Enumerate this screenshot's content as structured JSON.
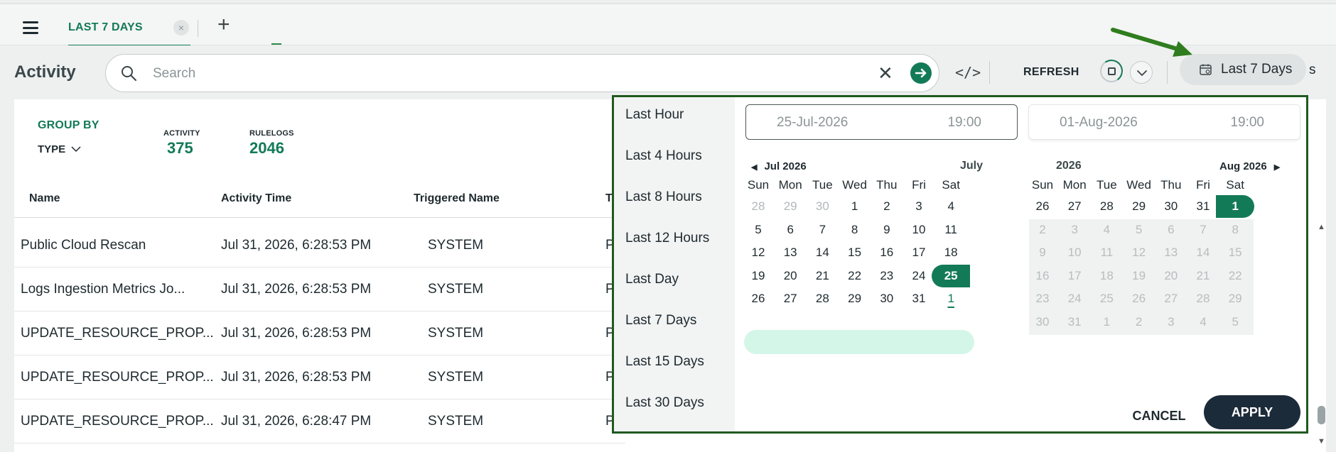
{
  "tabbar": {
    "active_tab": "LAST 7 DAYS",
    "close_glyph": "×",
    "add_glyph": "+"
  },
  "toolbar": {
    "title": "Activity",
    "search_placeholder": "Search",
    "clear_glyph": "✕",
    "code_glyph": "</>",
    "refresh_label": "REFRESH",
    "date_range_label": "Last 7 Days",
    "trailing_text": "s"
  },
  "summary": {
    "group_by_label": "GROUP BY",
    "type_label": "TYPE",
    "activity_label": "ACTIVITY",
    "activity_count": "375",
    "rulelogs_label": "RULELOGS",
    "rulelogs_count": "2046"
  },
  "table": {
    "columns": [
      "Name",
      "Activity Time",
      "Triggered Name",
      "T"
    ],
    "rows": [
      {
        "name": "Public Cloud Rescan",
        "time": "Jul 31, 2026, 6:28:53 PM",
        "triggered": "SYSTEM",
        "type": "P"
      },
      {
        "name": "Logs Ingestion Metrics Jo...",
        "time": "Jul 31, 2026, 6:28:53 PM",
        "triggered": "SYSTEM",
        "type": "P"
      },
      {
        "name": "UPDATE_RESOURCE_PROP...",
        "time": "Jul 31, 2026, 6:28:53 PM",
        "triggered": "SYSTEM",
        "type": "P"
      },
      {
        "name": "UPDATE_RESOURCE_PROP...",
        "time": "Jul 31, 2026, 6:28:53 PM",
        "triggered": "SYSTEM",
        "type": "P"
      },
      {
        "name": "UPDATE_RESOURCE_PROP...",
        "time": "Jul 31, 2026, 6:28:47 PM",
        "triggered": "SYSTEM",
        "type": "P"
      }
    ]
  },
  "date_picker": {
    "presets": [
      "Last Hour",
      "Last 4 Hours",
      "Last 8 Hours",
      "Last 12 Hours",
      "Last Day",
      "Last 7 Days",
      "Last 15 Days",
      "Last 30 Days"
    ],
    "start": {
      "date": "25-Jul-2026",
      "time": "19:00"
    },
    "end": {
      "date": "01-Aug-2026",
      "time": "19:00"
    },
    "left_month": {
      "nav_label": "Jul 2026",
      "month_label": "July",
      "weekdays": [
        "Sun",
        "Mon",
        "Tue",
        "Wed",
        "Thu",
        "Fri",
        "Sat"
      ],
      "weeks": [
        [
          "28",
          "29",
          "30",
          "1",
          "2",
          "3",
          "4"
        ],
        [
          "5",
          "6",
          "7",
          "8",
          "9",
          "10",
          "11"
        ],
        [
          "12",
          "13",
          "14",
          "15",
          "16",
          "17",
          "18"
        ],
        [
          "19",
          "20",
          "21",
          "22",
          "23",
          "24",
          "25"
        ],
        [
          "26",
          "27",
          "28",
          "29",
          "30",
          "31",
          "1"
        ]
      ]
    },
    "right_month": {
      "year_label": "2026",
      "nav_label": "Aug 2026",
      "weekdays": [
        "Sun",
        "Mon",
        "Tue",
        "Wed",
        "Thu",
        "Fri",
        "Sat"
      ],
      "weeks": [
        [
          "26",
          "27",
          "28",
          "29",
          "30",
          "31",
          "1"
        ],
        [
          "2",
          "3",
          "4",
          "5",
          "6",
          "7",
          "8"
        ],
        [
          "9",
          "10",
          "11",
          "12",
          "13",
          "14",
          "15"
        ],
        [
          "16",
          "17",
          "18",
          "19",
          "20",
          "21",
          "22"
        ],
        [
          "23",
          "24",
          "25",
          "26",
          "27",
          "28",
          "29"
        ],
        [
          "30",
          "31",
          "1",
          "2",
          "3",
          "4",
          "5"
        ]
      ]
    },
    "cancel_label": "CANCEL",
    "apply_label": "APPLY"
  },
  "colors": {
    "brand_green": "#137a57",
    "range_highlight": "#d4f6e9",
    "apply_bg": "#1c2b39",
    "popup_border": "#1f5a1f",
    "annotation_arrow": "#2f7d1e"
  }
}
